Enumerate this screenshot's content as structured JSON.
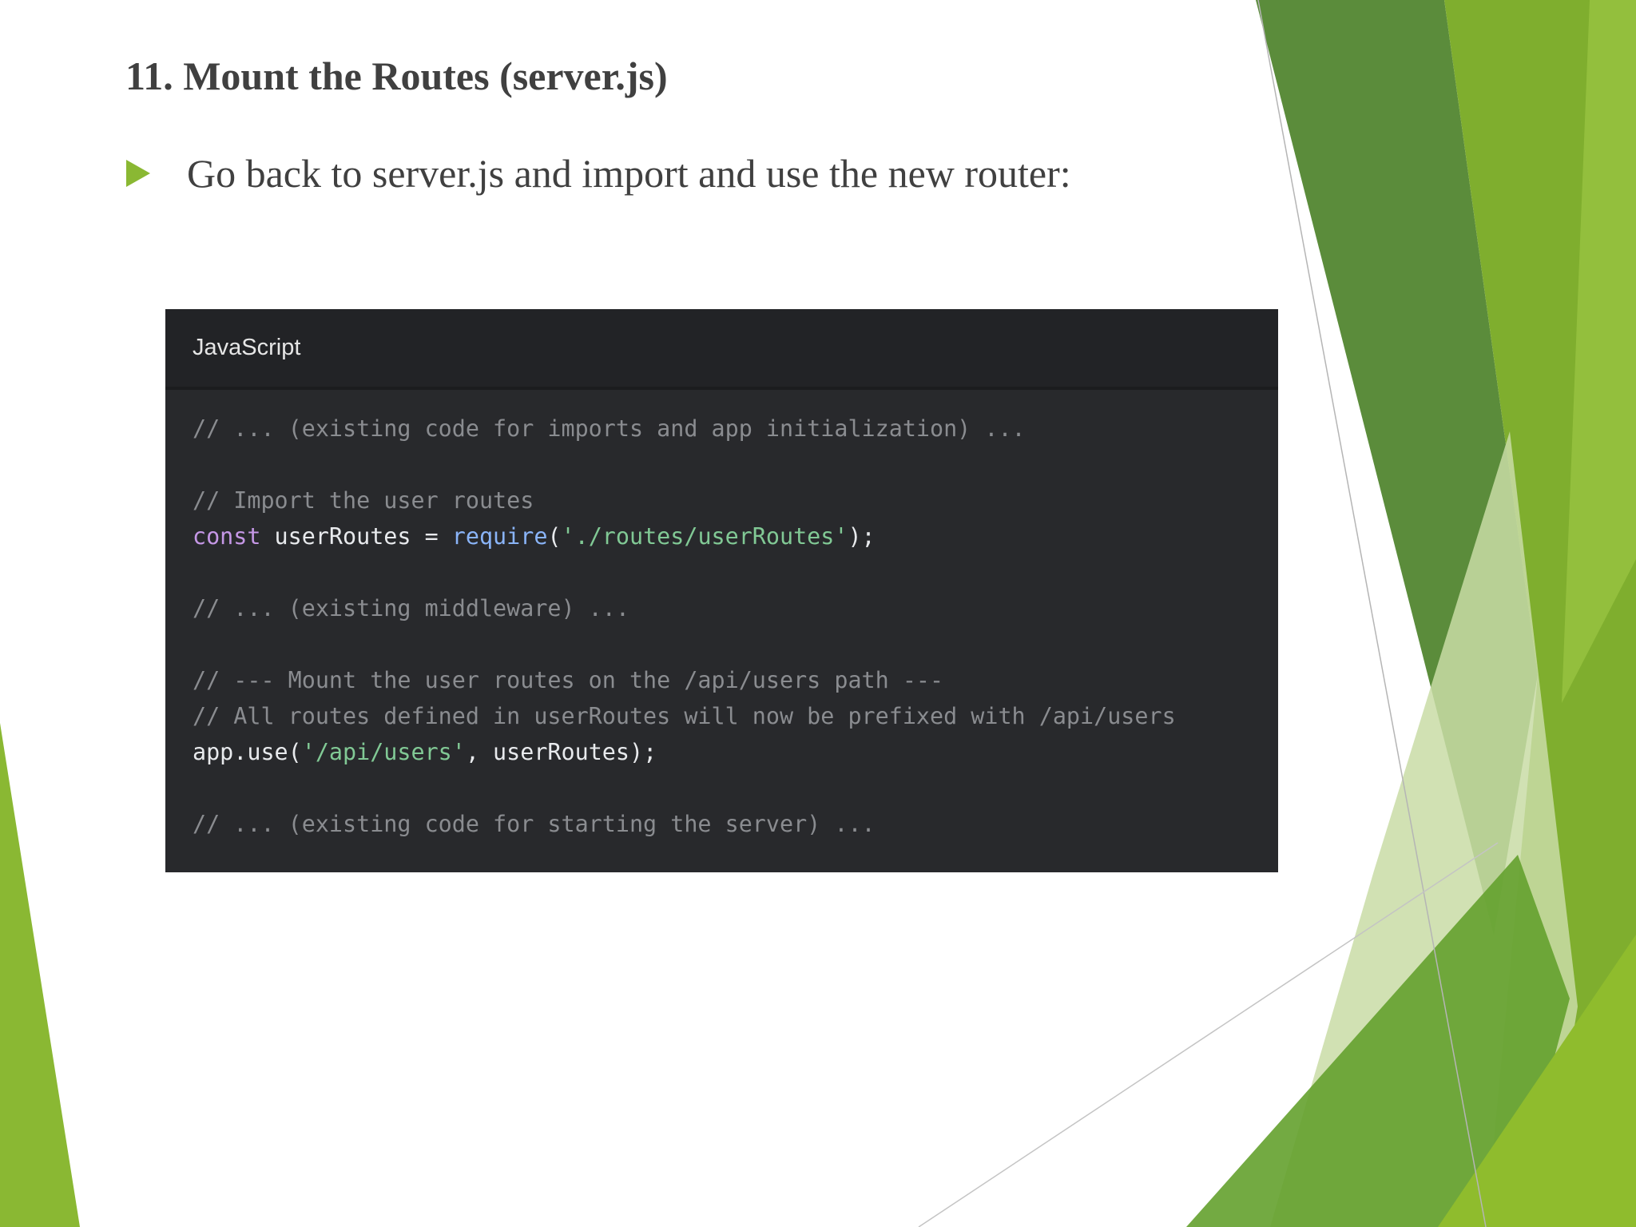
{
  "slide": {
    "title": "11. Mount the Routes (server.js)",
    "bullets": [
      "Go back to server.js and import and use the new router:"
    ]
  },
  "code_block": {
    "language": "JavaScript",
    "lines": [
      [
        {
          "t": "comment",
          "text": "// ... (existing code for imports and app initialization) ..."
        }
      ],
      [],
      [
        {
          "t": "comment",
          "text": "// Import the user routes"
        }
      ],
      [
        {
          "t": "keyword",
          "text": "const"
        },
        {
          "t": "plain",
          "text": " userRoutes = "
        },
        {
          "t": "func",
          "text": "require"
        },
        {
          "t": "plain",
          "text": "("
        },
        {
          "t": "string",
          "text": "'./routes/userRoutes'"
        },
        {
          "t": "plain",
          "text": ");"
        }
      ],
      [],
      [
        {
          "t": "comment",
          "text": "// ... (existing middleware) ..."
        }
      ],
      [],
      [
        {
          "t": "comment",
          "text": "// --- Mount the user routes on the /api/users path ---"
        }
      ],
      [
        {
          "t": "comment",
          "text": "// All routes defined in userRoutes will now be prefixed with /api/users"
        }
      ],
      [
        {
          "t": "plain",
          "text": "app.use("
        },
        {
          "t": "string",
          "text": "'/api/users'"
        },
        {
          "t": "plain",
          "text": ", userRoutes);"
        }
      ],
      [],
      [
        {
          "t": "comment",
          "text": "// ... (existing code for starting the server) ..."
        }
      ]
    ]
  },
  "colors": {
    "accent_green": "#8ab833",
    "dark_green": "#5a8a3a",
    "light_green": "#c9dca6",
    "code_background": "#28292c",
    "code_header": "#222326",
    "comment": "#8a8c90",
    "keyword": "#c597e6",
    "function": "#8ab4f8",
    "string": "#81c995"
  }
}
